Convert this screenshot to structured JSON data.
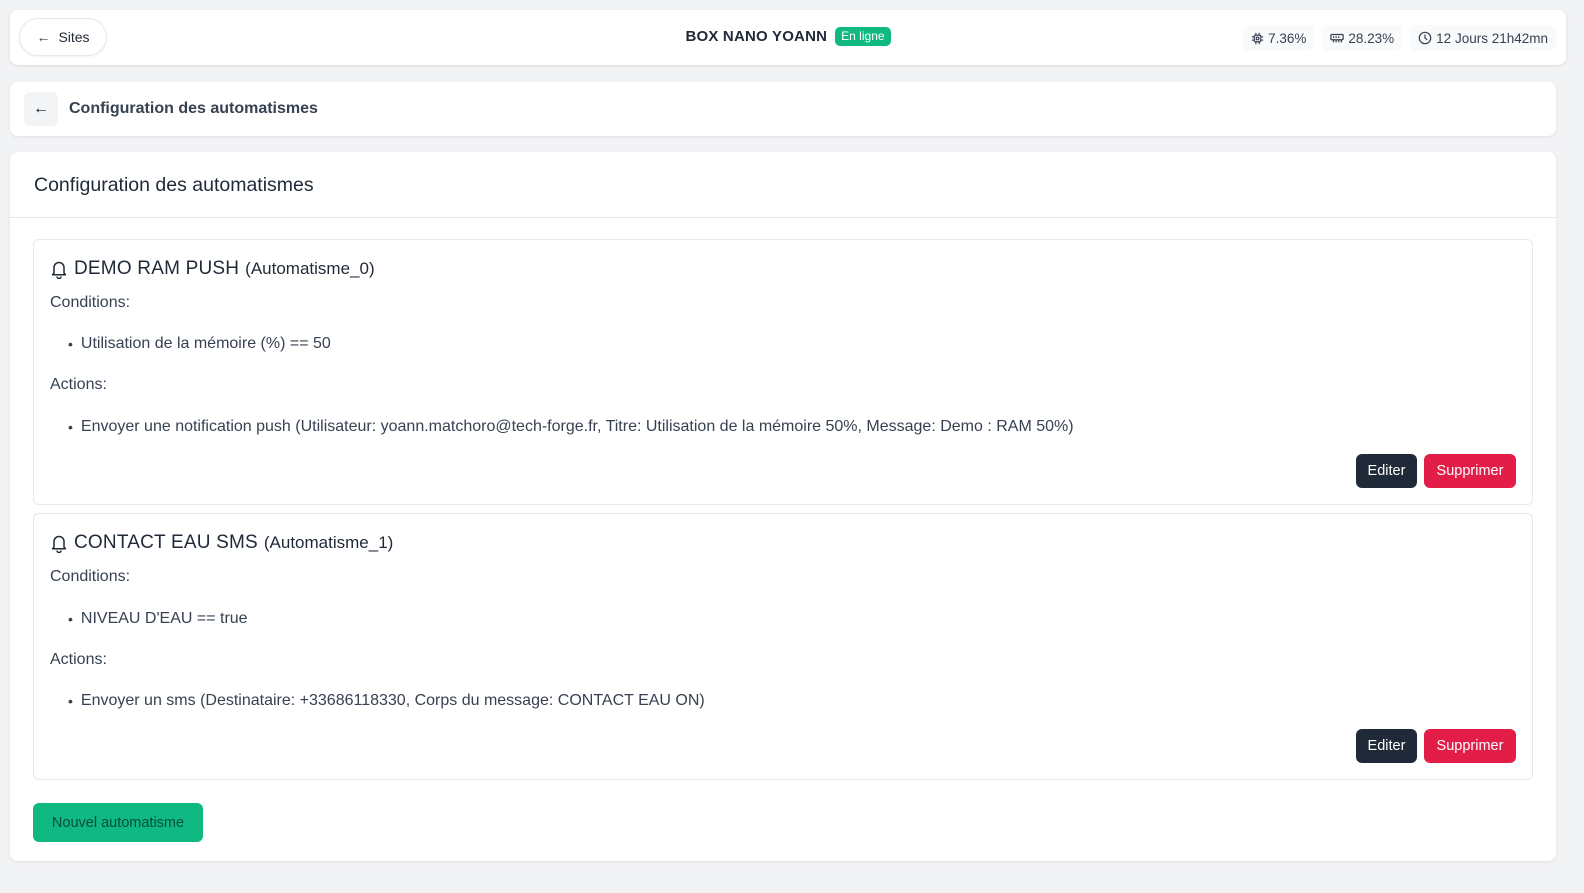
{
  "header": {
    "back_label": "Sites",
    "device_name": "BOX NANO YOANN",
    "status": "En ligne",
    "stats": {
      "cpu": "7.36%",
      "ram": "28.23%",
      "uptime": "12 Jours 21h42mn"
    }
  },
  "breadcrumb": {
    "title": "Configuration des automatismes"
  },
  "main": {
    "title": "Configuration des automatismes",
    "conditions_label": "Conditions:",
    "actions_label": "Actions:",
    "edit_label": "Editer",
    "delete_label": "Supprimer",
    "new_label": "Nouvel automatisme",
    "automations": [
      {
        "name": "DEMO RAM PUSH",
        "id": "(Automatisme_0)",
        "conditions": [
          "Utilisation de la mémoire (%) == 50"
        ],
        "actions": [
          "Envoyer une notification push (Utilisateur: yoann.matchoro@tech-forge.fr, Titre: Utilisation de la mémoire 50%, Message: Demo : RAM 50%)"
        ]
      },
      {
        "name": "CONTACT EAU SMS",
        "id": "(Automatisme_1)",
        "conditions": [
          "NIVEAU D'EAU == true"
        ],
        "actions": [
          "Envoyer un sms (Destinataire: +33686118330, Corps du message: CONTACT EAU ON)"
        ]
      }
    ]
  },
  "colors": {
    "accent_green": "#10b981",
    "danger": "#e11d48",
    "dark": "#1f2937"
  }
}
